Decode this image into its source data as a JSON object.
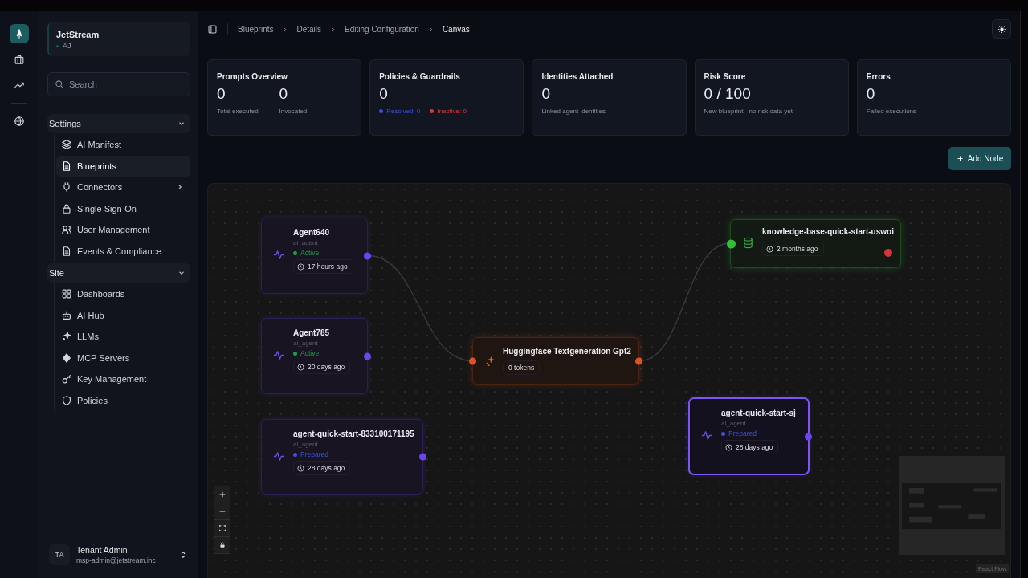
{
  "rail": [
    {
      "selected": true
    },
    {
      "selected": false
    },
    {
      "selected": false
    },
    {
      "selected": false
    }
  ],
  "workspace": {
    "name": "JetStream",
    "initials": "AJ"
  },
  "search": {
    "placeholder": "Search"
  },
  "sidebar": [
    {
      "title": "Settings",
      "expanded": true,
      "items": [
        {
          "label": "AI Manifest",
          "selected": false,
          "submenu": false
        },
        {
          "label": "Blueprints",
          "selected": true,
          "submenu": false
        },
        {
          "label": "Connectors",
          "selected": false,
          "submenu": true
        },
        {
          "label": "Single Sign-On",
          "selected": false,
          "submenu": false
        },
        {
          "label": "User Management",
          "selected": false,
          "submenu": false
        },
        {
          "label": "Events & Compliance",
          "selected": false,
          "submenu": false
        }
      ]
    },
    {
      "title": "Site",
      "expanded": true,
      "items": [
        {
          "label": "Dashboards",
          "selected": false,
          "submenu": false
        },
        {
          "label": "AI Hub",
          "selected": false,
          "submenu": false
        },
        {
          "label": "LLMs",
          "selected": false,
          "submenu": false
        },
        {
          "label": "MCP Servers",
          "selected": false,
          "submenu": false
        },
        {
          "label": "Key Management",
          "selected": false,
          "submenu": false
        },
        {
          "label": "Policies",
          "selected": false,
          "submenu": false
        }
      ]
    }
  ],
  "user": {
    "initials": "TA",
    "name": "Tenant Admin",
    "email": "msp-admin@jetstream.inc"
  },
  "breadcrumb": [
    "Blueprints",
    "Details",
    "Editing Configuration",
    "Canvas"
  ],
  "stats": [
    {
      "title": "Prompts Overview",
      "metrics": [
        {
          "value": "0",
          "label": "Total executed"
        },
        {
          "value": "0",
          "label": "Invocated"
        }
      ]
    },
    {
      "title": "Policies & Guardrails",
      "metrics": [
        {
          "value": "0"
        }
      ],
      "legend": [
        {
          "text": "Resolved: 0",
          "color": "#3b4fe0"
        },
        {
          "text": "Inactive: 0",
          "color": "#d9363e"
        }
      ]
    },
    {
      "title": "Identities Attached",
      "metrics": [
        {
          "value": "0",
          "label": "Linked agent identities"
        }
      ]
    },
    {
      "title": "Risk Score",
      "metrics": [
        {
          "value": "0 / 100",
          "label": "New blueprint - no risk data yet"
        }
      ]
    },
    {
      "title": "Errors",
      "metrics": [
        {
          "value": "0",
          "label": "Failed executions"
        }
      ]
    }
  ],
  "add_button": "Add Node",
  "nodes": [
    {
      "kind": "agent",
      "name": "Agent640",
      "type": "ai_agent",
      "status": "Active",
      "color": "#16a34a",
      "time": "17 hours ago",
      "selected": false
    },
    {
      "kind": "agent",
      "name": "Agent785",
      "type": "ai_agent",
      "status": "Active",
      "color": "#16a34a",
      "time": "20 days ago",
      "selected": false
    },
    {
      "kind": "agent",
      "name": "agent-quick-start-833100171195",
      "type": "ai_agent",
      "status": "Prepared",
      "color": "#3b4fe0",
      "time": "28 days ago",
      "selected": false
    },
    {
      "kind": "model",
      "name": "Huggingface Textgeneration Gpt2",
      "tokens": "0 tokens",
      "selected": false
    },
    {
      "kind": "knowledge",
      "name": "knowledge-base-quick-start-uswoi",
      "time": "2 months ago",
      "selected": false
    },
    {
      "kind": "agent",
      "name": "agent-quick-start-sj",
      "type": "ai_agent",
      "status": "Prepared",
      "color": "#3b4fe0",
      "time": "28 days ago",
      "selected": true
    }
  ],
  "attribution": "React Flow"
}
